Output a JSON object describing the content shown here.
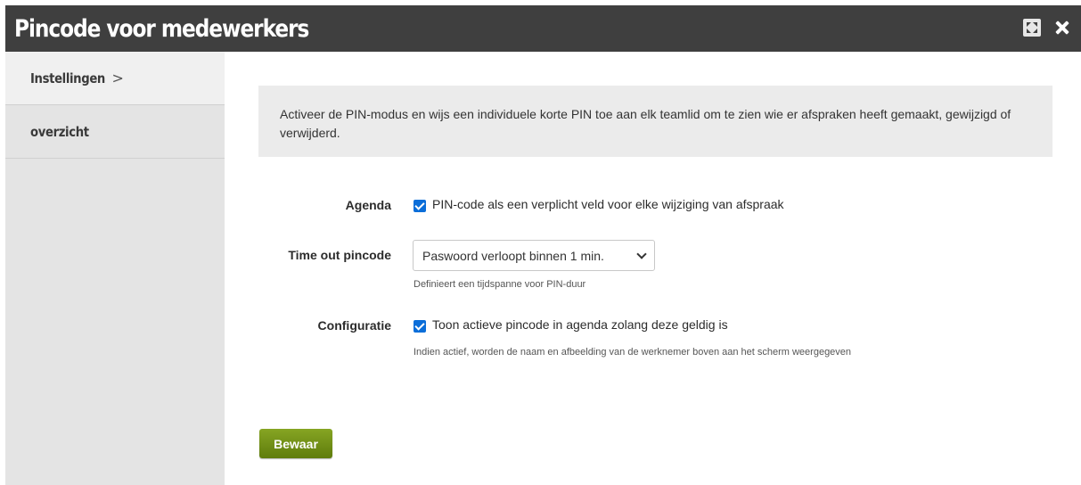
{
  "window": {
    "title": "Pincode voor medewerkers",
    "expand_icon": "expand-icon",
    "close_icon": "close-icon"
  },
  "sidebar": {
    "items": [
      {
        "label": "Instellingen",
        "chevron": ">",
        "active": true
      },
      {
        "label": "overzicht",
        "active": false
      }
    ]
  },
  "info": {
    "text": "Activeer de PIN-modus en wijs een individuele korte PIN toe aan elk teamlid om te zien wie er afspraken heeft gemaakt, gewijzigd of verwijderd."
  },
  "form": {
    "agenda": {
      "label": "Agenda",
      "checked": true,
      "checkbox_label": "PIN-code als een verplicht veld voor elke wijziging van afspraak"
    },
    "timeout": {
      "label": "Time out pincode",
      "selected": "Paswoord verloopt binnen 1 min.",
      "help": "Definieert een tijdspanne voor PIN-duur"
    },
    "configuratie": {
      "label": "Configuratie",
      "checked": true,
      "checkbox_label": "Toon actieve pincode in agenda zolang deze geldig is",
      "help": "Indien actief, worden de naam en afbeelding van de werknemer boven aan het scherm weergegeven"
    }
  },
  "actions": {
    "save_label": "Bewaar"
  },
  "colors": {
    "titlebar": "#3f3f3f",
    "sidebar": "#e4e4e4",
    "checkbox": "#0b6ed9",
    "save_button": "#6f8c16"
  }
}
